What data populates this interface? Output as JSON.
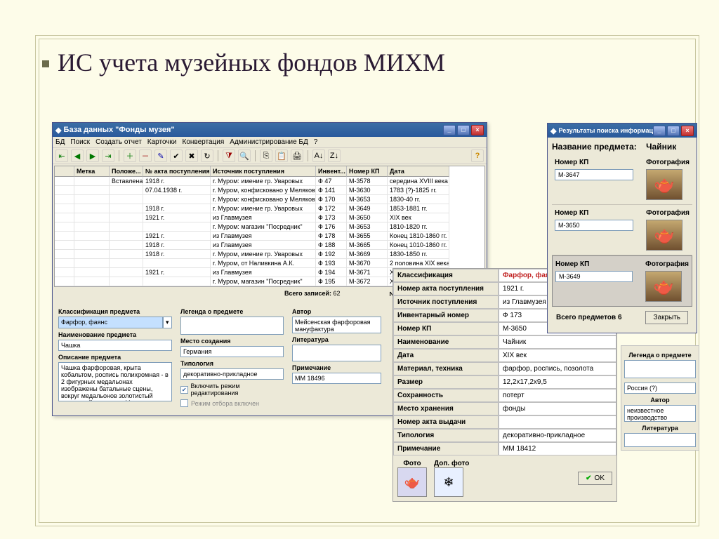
{
  "slide": {
    "title": "ИС учета музейных фондов МИХМ"
  },
  "mainwin": {
    "title": "База данных \"Фонды музея\"",
    "menus": [
      "БД",
      "Поиск",
      "Создать отчет",
      "Карточки",
      "Конвертация",
      "Администрирование БД",
      "?"
    ],
    "cols": [
      "",
      "Метка",
      "Положе...",
      "№ акта поступления",
      "Источник поступления",
      "Инвент...",
      "Номер КП",
      "Дата"
    ],
    "rows": [
      [
        "",
        "",
        "Вставлена",
        "1918 г.",
        "г. Муром: имение гр. Уваровых",
        "Ф 47",
        "М-3578",
        "середина XVIII века"
      ],
      [
        "",
        "",
        "",
        "07.04.1938 г.",
        "г. Муром, конфисковано у Мелякова",
        "Ф 141",
        "М-3630",
        "1783 (?)-1825 гг."
      ],
      [
        "",
        "",
        "",
        "",
        "г. Муром: конфисковано у Мелякова",
        "Ф 170",
        "М-3653",
        "1830-40 гг."
      ],
      [
        "",
        "",
        "",
        "1918 г.",
        "г. Муром: имение гр. Уваровых",
        "Ф 172",
        "М-3649",
        "1853-1881 гг."
      ],
      [
        "",
        "",
        "",
        "1921 г.",
        "из Главмузея",
        "Ф 173",
        "М-3650",
        "XIX век"
      ],
      [
        "",
        "",
        "",
        "",
        "г. Муром: магазин \"Посредник\"",
        "Ф 176",
        "М-3653",
        "1810-1820 гг."
      ],
      [
        "",
        "",
        "",
        "1921 г.",
        "из Главмузея",
        "Ф 178",
        "М-3655",
        "Конец 1810-1860 гг."
      ],
      [
        "",
        "",
        "",
        "1918 г.",
        "из Главмузея",
        "Ф 188",
        "М-3665",
        "Конец 1010-1860 гг."
      ],
      [
        "",
        "",
        "",
        "1918 г.",
        "г. Муром, имение гр. Уваровых",
        "Ф 192",
        "М-3669",
        "1830-1850 гг."
      ],
      [
        "",
        "",
        "",
        "",
        "г. Муром, от Наливкина А.К.",
        "Ф 193",
        "М-3670",
        "2 половина XIX века"
      ],
      [
        "",
        "",
        "",
        "1921 г.",
        "из Главмузея",
        "Ф 194",
        "М-3671",
        "XIX век"
      ],
      [
        "",
        "",
        "",
        "",
        "г. Муром, магазин \"Посредник\"",
        "Ф 195",
        "М-3672",
        "XIX век"
      ]
    ],
    "total_label": "Всего записей:",
    "total_value": "62",
    "issue_label": "№ акта выдачи",
    "class_label": "Классификация предмета",
    "class_value": "Фарфор, фаянс",
    "name_label": "Наименование предмета",
    "name_value": "Чашка",
    "desc_label": "Описание предмета",
    "desc_value": "Чашка фарфоровая, крыта кобальтом, роспись полихромная - в 2 фигурных медальонах изображены батальные сцены, вокруг медальонов золотистый цветочный орнамент. Марка синяя подглазурная.",
    "legend_label": "Легенда о предмете",
    "author_label": "Автор",
    "author_value": "Мейсенская фарфоровая мануфактура",
    "place_label": "Место создания",
    "place_value": "Германия",
    "typology_label": "Типология",
    "typology_value": "декоративно-прикладное",
    "lit_label": "Литература",
    "note_label": "Примечание",
    "note_value": "ММ 18496",
    "edit_mode": "Включить режим редактирования",
    "filter_mode": "Режим отбора включен"
  },
  "detail": {
    "rows": [
      {
        "lab": "Классификация",
        "val": "Фарфор, фаянс",
        "red": true
      },
      {
        "lab": "Номер акта поступления",
        "val": "1921 г."
      },
      {
        "lab": "Источник поступления",
        "val": "из Главмузея"
      },
      {
        "lab": "Инвентарный номер",
        "val": "Ф 173"
      },
      {
        "lab": "Номер КП",
        "val": "М-3650"
      },
      {
        "lab": "Наименование",
        "val": "Чайник"
      },
      {
        "lab": "Дата",
        "val": "XIX век"
      },
      {
        "lab": "Материал, техника",
        "val": "фарфор, роспись, позолота"
      },
      {
        "lab": "Размер",
        "val": "12,2х17,2х9,5"
      },
      {
        "lab": "Сохранность",
        "val": "потерт"
      },
      {
        "lab": "Место хранения",
        "val": "фонды"
      },
      {
        "lab": "Номер акта выдачи",
        "val": ""
      },
      {
        "lab": "Типология",
        "val": "декоративно-прикладное"
      },
      {
        "lab": "Примечание",
        "val": "ММ 18412"
      }
    ],
    "photo_lab": "Фото",
    "photo2_lab": "Доп. фото",
    "ok": "OK"
  },
  "results": {
    "title": "Результаты поиска информации о музейном предмете",
    "subject_label": "Название предмета:",
    "subject_value": "Чайник",
    "kp_label": "Номер КП",
    "photo_label": "Фотография",
    "items": [
      {
        "kp": "М-3647"
      },
      {
        "kp": "М-3650"
      },
      {
        "kp": "М-3649"
      }
    ],
    "total_label": "Всего предметов",
    "total_value": "6",
    "close": "Закрыть"
  },
  "legend_strip": {
    "legend": "Легенда о предмете",
    "country": "Россия (?)",
    "author": "Автор",
    "author_val": "неизвестное производство",
    "lit": "Литература"
  }
}
